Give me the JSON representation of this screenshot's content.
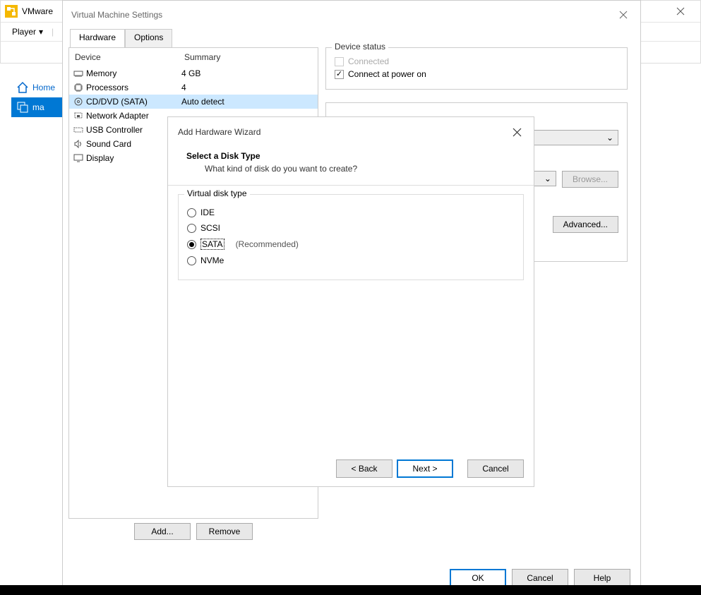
{
  "main": {
    "title": "VMware",
    "menu_player": "Player",
    "sidebar": {
      "home": "Home",
      "vm": "ma"
    }
  },
  "settings": {
    "title": "Virtual Machine Settings",
    "tabs": {
      "hardware": "Hardware",
      "options": "Options"
    },
    "device_table": {
      "col_device": "Device",
      "col_summary": "Summary",
      "rows": [
        {
          "name": "Memory",
          "summary": "4 GB"
        },
        {
          "name": "Processors",
          "summary": "4"
        },
        {
          "name": "CD/DVD (SATA)",
          "summary": "Auto detect"
        },
        {
          "name": "Network Adapter",
          "summary": ""
        },
        {
          "name": "USB Controller",
          "summary": ""
        },
        {
          "name": "Sound Card",
          "summary": ""
        },
        {
          "name": "Display",
          "summary": ""
        }
      ]
    },
    "device_status": {
      "group": "Device status",
      "connected": "Connected",
      "connect_power": "Connect at power on"
    },
    "advanced": "Advanced...",
    "browse": "Browse...",
    "add": "Add...",
    "remove": "Remove",
    "ok": "OK",
    "cancel": "Cancel",
    "help": "Help"
  },
  "wizard": {
    "title": "Add Hardware Wizard",
    "header": "Select a Disk Type",
    "sub": "What kind of disk do you want to create?",
    "group": "Virtual disk type",
    "options": {
      "ide": "IDE",
      "scsi": "SCSI",
      "sata": "SATA",
      "nvme": "NVMe"
    },
    "recommended": "(Recommended)",
    "back": "< Back",
    "next": "Next >",
    "cancel": "Cancel"
  }
}
